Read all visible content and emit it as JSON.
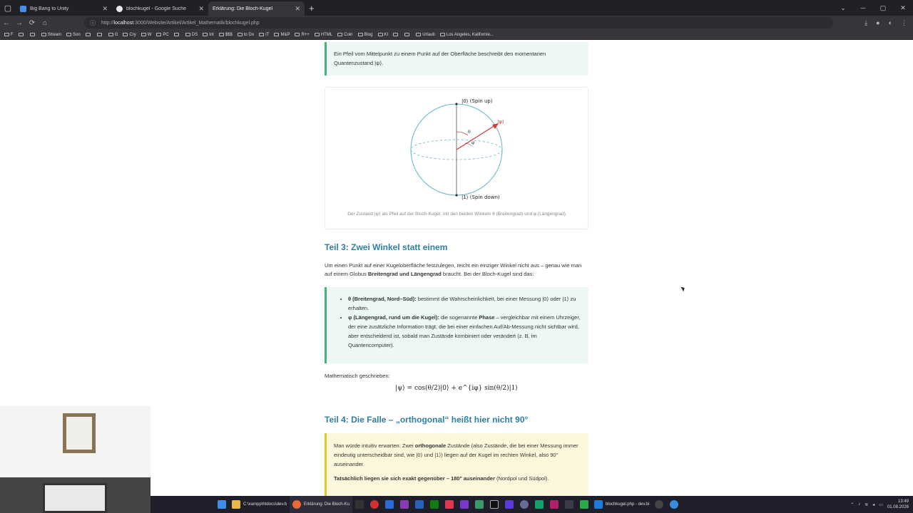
{
  "browser": {
    "tabs": [
      {
        "title": "Big Bang to Unity",
        "fav_color": "#4a8fe7",
        "active": false
      },
      {
        "title": "blochkugel - Google Suche",
        "fav_color": "#e8e8e8",
        "active": false
      },
      {
        "title": "Erklärung: Die Bloch-Kugel",
        "fav_color": "#35363a",
        "active": true
      }
    ],
    "new_tab": "+",
    "url_host": "localhost",
    "url_rest": ":3000/Website/Artikel/Artikel_Mathematik/blochkugel.php",
    "url_prefix": "http://",
    "bookmarks": [
      "F",
      "",
      "",
      "Stream",
      "Son",
      "",
      "",
      "G",
      "Cry",
      "W",
      "PC",
      "",
      "DS",
      "Int",
      "$$$",
      "to Do",
      "IT",
      "M&P",
      "R++",
      "HTML",
      "Coin",
      "Blog",
      "KI",
      "",
      "",
      "Urlaub",
      "Los Angeles, Kalifornie..."
    ]
  },
  "article": {
    "intro_callout": "Ein Pfeil vom Mittelpunkt zu einem Punkt auf der Oberfläche beschreibt den momentanen Quantenzustand |ψ⟩.",
    "figure": {
      "label_top": "|0⟩ (Spin up)",
      "label_bottom": "|1⟩ (Spin down)",
      "label_psi": "|ψ⟩",
      "label_theta": "θ",
      "label_phi": "φ",
      "caption": "Der Zustand |ψ⟩ als Pfeil auf der Bloch-Kugel, mit den beiden Winkeln θ (Breitengrad) und φ (Längengrad)."
    },
    "part3": {
      "heading": "Teil 3: Zwei Winkel statt einem",
      "para_a": "Um einen Punkt auf einer Kugeloberfläche festzulegen, reicht ein einziger Winkel nicht aus – genau wie man auf einem Globus ",
      "para_bold": "Breitengrad und Längengrad",
      "para_b": " braucht. Bei der Bloch-Kugel sind das:",
      "item1_bold": "θ (Breitengrad, Nord–Süd):",
      "item1_text": " bestimmt die Wahrscheinlichkeit, bei einer Messung |0⟩ oder |1⟩ zu erhalten.",
      "item2_bold": "φ (Längengrad, rund um die Kugel):",
      "item2_text_a": " die sogenannte ",
      "item2_bold2": "Phase",
      "item2_text_b": " – vergleichbar mit einem Uhrzeiger, der eine zusätzliche Information trägt, die bei einer einfachen Auf/Ab-Messung nicht sichtbar wird, aber entscheidend ist, sobald man Zustände kombiniert oder verändert (z. B. im Quantencomputer).",
      "math_intro": "Mathematisch geschrieben:",
      "formula": "|ψ⟩ = cos(θ/2)|0⟩ + e^{iφ} sin(θ/2)|1⟩"
    },
    "part4": {
      "heading": "Teil 4: Die Falle – „orthogonal“ heißt hier nicht 90°",
      "p1_a": "Man würde intuitiv erwarten: Zwei ",
      "p1_bold": "orthogonale",
      "p1_b": " Zustände (also Zustände, die bei einer Messung immer eindeutig unterscheidbar sind, wie |0⟩ und |1⟩) liegen auf der Kugel im rechten Winkel, also 90° auseinander.",
      "p2_bold": "Tatsächlich liegen sie sich exakt gegenüber – 180° auseinander",
      "p2_rest": " (Nordpol und Südpol)."
    }
  },
  "taskbar": {
    "explorer_label": "C:\\xampp\\htdocs\\dev.b",
    "browser_label": "Erklärung: Die Bloch-Ku",
    "vscode_label": "blochkugel.php - dev.bi",
    "time": "13:49",
    "date": "01.08.2026"
  },
  "colors": {
    "accent_heading": "#2d7fa6",
    "green_callout": "#3bb873",
    "yellow_callout": "#e6c430",
    "arrow": "#d23b3b"
  }
}
